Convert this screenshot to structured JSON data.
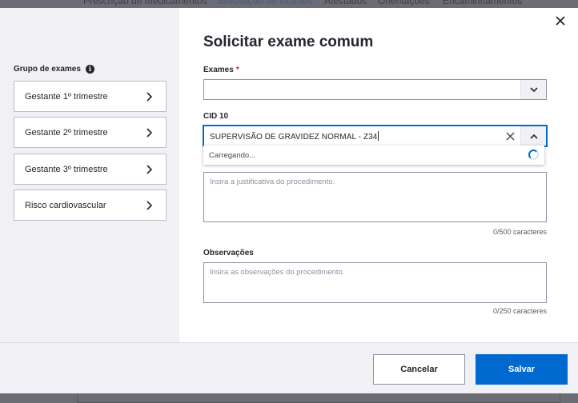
{
  "background": {
    "tabs": [
      "Prescrição de medicamentos",
      "Solicitação de exames",
      "Atestados",
      "Orientações",
      "Encaminhamentos"
    ]
  },
  "modal": {
    "title": "Solicitar exame comum",
    "sidebar": {
      "title": "Grupo de exames",
      "groups": [
        "Gestante 1º trimestre",
        "Gestante 2º trimestre",
        "Gestante 3º trimestre",
        "Risco cardiovascular"
      ]
    },
    "exames": {
      "label": "Exames",
      "required_mark": "*",
      "value": ""
    },
    "cid10": {
      "label": "CID 10",
      "value": "SUPERVISÃO DE GRAVIDEZ NORMAL - Z34",
      "dropdown_status": "Carregando..."
    },
    "justificativa": {
      "placeholder": "Insira a justificativa do procedimento.",
      "counter": "0/500 caracteres"
    },
    "observacoes": {
      "label": "Observações",
      "placeholder": "Insira as observações do procedimento.",
      "counter": "0/250 caracteres"
    },
    "footer": {
      "cancel": "Cancelar",
      "save": "Salvar"
    }
  },
  "colors": {
    "primary": "#0069d0",
    "required": "#d01f2e",
    "sidebar_bg": "#f0f0f5"
  }
}
